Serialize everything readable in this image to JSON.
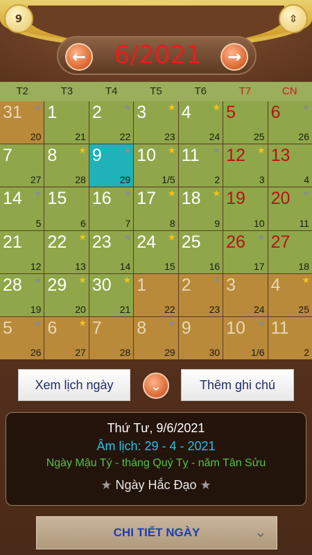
{
  "header": {
    "left_badge": "9",
    "month_title": "6/2021",
    "prev_icon": "←",
    "next_icon": "→",
    "right_icon": "⇳"
  },
  "weekdays": [
    "T2",
    "T3",
    "T4",
    "T5",
    "T6",
    "T7",
    "CN"
  ],
  "cells": [
    {
      "day": "31",
      "lunar": "20",
      "star": "grey",
      "kind": "other"
    },
    {
      "day": "1",
      "lunar": "21",
      "star": "",
      "kind": "cur"
    },
    {
      "day": "2",
      "lunar": "22",
      "star": "grey",
      "kind": "cur"
    },
    {
      "day": "3",
      "lunar": "23",
      "star": "gold",
      "kind": "cur"
    },
    {
      "day": "4",
      "lunar": "24",
      "star": "gold",
      "kind": "cur"
    },
    {
      "day": "5",
      "lunar": "25",
      "star": "",
      "kind": "red"
    },
    {
      "day": "6",
      "lunar": "26",
      "star": "grey",
      "kind": "red"
    },
    {
      "day": "7",
      "lunar": "27",
      "star": "",
      "kind": "cur"
    },
    {
      "day": "8",
      "lunar": "28",
      "star": "gold",
      "kind": "cur"
    },
    {
      "day": "9",
      "lunar": "29",
      "star": "grey",
      "kind": "today"
    },
    {
      "day": "10",
      "lunar": "1/5",
      "star": "gold",
      "kind": "cur"
    },
    {
      "day": "11",
      "lunar": "2",
      "star": "grey",
      "kind": "cur"
    },
    {
      "day": "12",
      "lunar": "3",
      "star": "gold",
      "kind": "red"
    },
    {
      "day": "13",
      "lunar": "4",
      "star": "",
      "kind": "red"
    },
    {
      "day": "14",
      "lunar": "5",
      "star": "grey",
      "kind": "cur"
    },
    {
      "day": "15",
      "lunar": "6",
      "star": "",
      "kind": "cur"
    },
    {
      "day": "16",
      "lunar": "7",
      "star": "grey",
      "kind": "cur"
    },
    {
      "day": "17",
      "lunar": "8",
      "star": "gold",
      "kind": "cur"
    },
    {
      "day": "18",
      "lunar": "9",
      "star": "gold",
      "kind": "cur"
    },
    {
      "day": "19",
      "lunar": "10",
      "star": "",
      "kind": "red"
    },
    {
      "day": "20",
      "lunar": "11",
      "star": "grey",
      "kind": "red"
    },
    {
      "day": "21",
      "lunar": "12",
      "star": "",
      "kind": "cur"
    },
    {
      "day": "22",
      "lunar": "13",
      "star": "gold",
      "kind": "cur"
    },
    {
      "day": "23",
      "lunar": "14",
      "star": "grey",
      "kind": "cur"
    },
    {
      "day": "24",
      "lunar": "15",
      "star": "gold",
      "kind": "cur"
    },
    {
      "day": "25",
      "lunar": "16",
      "star": "",
      "kind": "cur"
    },
    {
      "day": "26",
      "lunar": "17",
      "star": "grey",
      "kind": "red"
    },
    {
      "day": "27",
      "lunar": "18",
      "star": "",
      "kind": "red"
    },
    {
      "day": "28",
      "lunar": "19",
      "star": "grey",
      "kind": "cur"
    },
    {
      "day": "29",
      "lunar": "20",
      "star": "gold",
      "kind": "cur"
    },
    {
      "day": "30",
      "lunar": "21",
      "star": "gold",
      "kind": "cur"
    },
    {
      "day": "1",
      "lunar": "22",
      "star": "",
      "kind": "other"
    },
    {
      "day": "2",
      "lunar": "23",
      "star": "grey",
      "kind": "other"
    },
    {
      "day": "3",
      "lunar": "24",
      "star": "",
      "kind": "other"
    },
    {
      "day": "4",
      "lunar": "25",
      "star": "gold",
      "kind": "other"
    },
    {
      "day": "5",
      "lunar": "26",
      "star": "grey",
      "kind": "other"
    },
    {
      "day": "6",
      "lunar": "27",
      "star": "gold",
      "kind": "other"
    },
    {
      "day": "7",
      "lunar": "28",
      "star": "",
      "kind": "other"
    },
    {
      "day": "8",
      "lunar": "29",
      "star": "grey",
      "kind": "other"
    },
    {
      "day": "9",
      "lunar": "30",
      "star": "",
      "kind": "other"
    },
    {
      "day": "10",
      "lunar": "1/6",
      "star": "grey",
      "kind": "other"
    },
    {
      "day": "11",
      "lunar": "2",
      "star": "",
      "kind": "other"
    }
  ],
  "buttons": {
    "view_day": "Xem lịch ngày",
    "add_note": "Thêm ghi chú",
    "toggle_icon": "⌄"
  },
  "info": {
    "date": "Thứ Tư, 9/6/2021",
    "lunar": "Âm lịch: 29  -  4  -  2021",
    "canchi": "Ngày Mậu Tý - tháng Quý Tỵ - năm Tân Sửu",
    "status": "Ngày Hắc Đạo",
    "star": "★"
  },
  "detail": {
    "label": "CHI TIẾT NGÀY",
    "chevron": "⌄"
  },
  "colors": {
    "current_cell": "#8fa74a",
    "other_cell": "#b98a3a",
    "today_cell": "#1fb2b8",
    "weekend_text": "#b41414",
    "title_red": "#e61e1e"
  }
}
